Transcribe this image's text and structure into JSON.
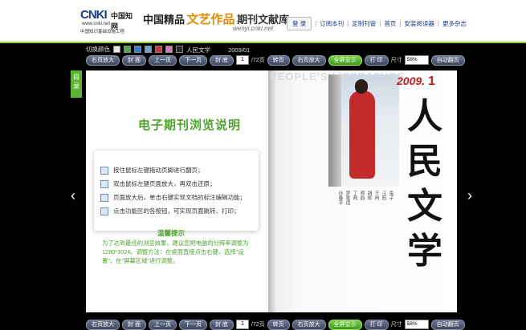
{
  "header": {
    "brand": "CNKI",
    "brand_mark": "中国知网",
    "url": "www.cnki.net",
    "tagline": "中国知识基础设施工程",
    "title_part1": "中国精品",
    "title_part2": "文艺作品",
    "title_part3": "期刊文献库",
    "domain": "wenyi.cnki.net",
    "nav": {
      "login": "登 录",
      "subscribe": "订阅本刊",
      "custom_push": "定制刊管",
      "home": "首页",
      "install_reader": "安装阅读器",
      "more_magazines": "更多杂志"
    }
  },
  "colorbar": {
    "label": "切换颜色",
    "swatches": [
      "#e8e8e8",
      "#4cae3c",
      "#3a78c8",
      "#6aa7d8",
      "#c23a3a",
      "#d979b9",
      "#2b2b2b"
    ],
    "magazine": "人民文学",
    "issue": "2009/01"
  },
  "toolbar": {
    "fit_page": "右页放大",
    "cover": "封 面",
    "prev": "上一页",
    "next": "下一页",
    "back_cover": "封 底",
    "page_current": "1",
    "page_total": "/72页",
    "jump": "转页",
    "fit_page_right": "右页放大",
    "fullscreen": "全屏显示",
    "print": "打 印",
    "zoom_label": "尺寸",
    "zoom_value": "58%",
    "auto_zoom": "自动翻页"
  },
  "left_page": {
    "directory_tab": "目录",
    "guide_title": "电子期刊浏览说明",
    "instructions": [
      "按住鼠标左键拖动页脚进行翻页；",
      "双击鼠标左键页面放大，再双击还原；",
      "页面放大后，单击右键实现文档的标注编辑功能；",
      "点击功能区的各按钮，可实现页面跳转、打印；"
    ],
    "tip_title": "温馨提示",
    "tip_body": "为了达到最佳的浏览效果，建议您把电脑的分辨率调整为1280*1024。调整方法：在桌面直接点击右键，选择\"设置\"，在\"屏幕区域\"进行调整。"
  },
  "right_page": {
    "masthead": "PEOPLE'S LITERATURE",
    "year": "2009.",
    "issue_number": "1",
    "calligraphy": "人民文学",
    "cover_columns": [
      "孙春平",
      "梦笔宿",
      "丁燕",
      "蒋韵",
      "胡辉",
      "王冉",
      "汪阳",
      "鬼子",
      "王文"
    ]
  },
  "arrows": {
    "left": "‹",
    "right": "›"
  }
}
